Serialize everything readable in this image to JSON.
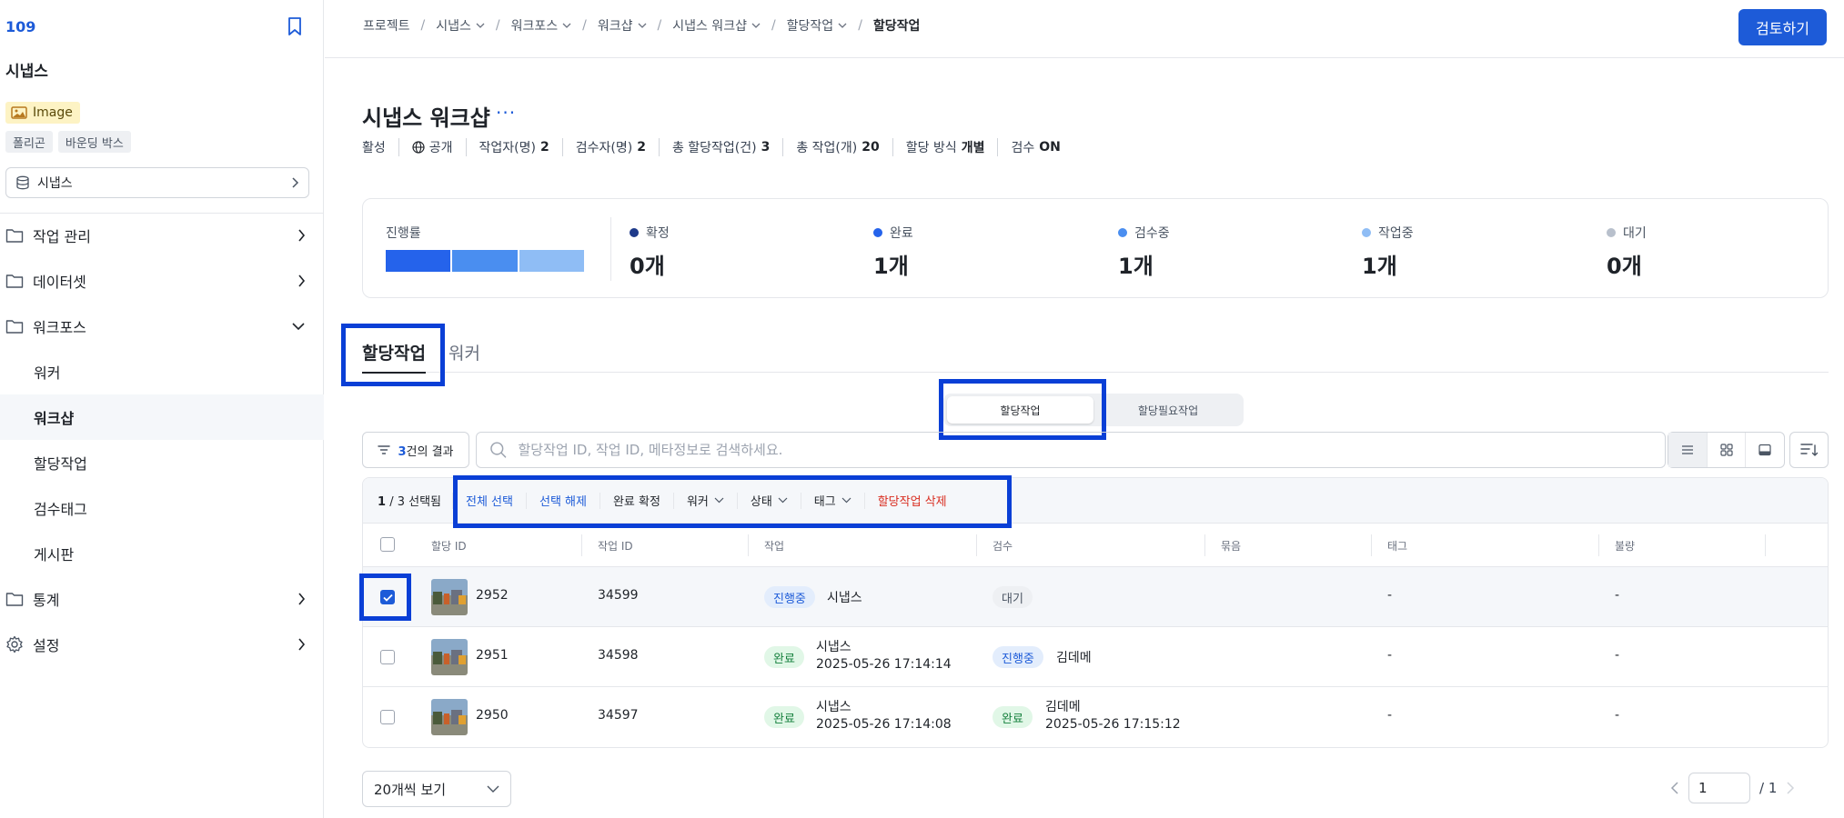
{
  "sidebar": {
    "project_id": "109",
    "project_title": "시냅스",
    "data_type": "Image",
    "annotation_tags": [
      "폴리곤",
      "바운딩 박스"
    ],
    "dataset_selector": "시냅스",
    "nav": {
      "work_mgmt": "작업 관리",
      "dataset": "데이터셋",
      "workforce": "워크포스",
      "worker": "워커",
      "workshop": "워크샵",
      "assigned": "할당작업",
      "review_tag": "검수태그",
      "board": "게시판",
      "stats": "통계",
      "settings": "설정"
    }
  },
  "breadcrumb": {
    "project": "프로젝트",
    "synapse": "시냅스",
    "workforce": "워크포스",
    "workshop": "워크샵",
    "synapse_workshop": "시냅스 워크샵",
    "assigned": "할당작업",
    "current": "할당작업"
  },
  "header": {
    "review_button": "검토하기",
    "title": "시냅스 워크샵",
    "more": "···",
    "status": "활성",
    "visibility": "공개",
    "workers_label": "작업자(명)",
    "workers": "2",
    "reviewers_label": "검수자(명)",
    "reviewers": "2",
    "total_assign_label": "총 할당작업(건)",
    "total_assign": "3",
    "total_tasks_label": "총 작업(개)",
    "total_tasks": "20",
    "assign_mode_label": "할당 방식",
    "assign_mode": "개별",
    "review_label": "검수",
    "review_value": "ON"
  },
  "stats": {
    "progress_label": "진행률",
    "progress_segments": [
      {
        "fraction": 0.3333,
        "color": "#2563eb"
      },
      {
        "fraction": 0.3333,
        "color": "#4a8ef0"
      },
      {
        "fraction": 0.3333,
        "color": "#8fbdf5"
      }
    ],
    "items": [
      {
        "label": "확정",
        "value": "0개",
        "color": "#1e3a8a"
      },
      {
        "label": "완료",
        "value": "1개",
        "color": "#2563eb"
      },
      {
        "label": "검수중",
        "value": "1개",
        "color": "#4a8ef0"
      },
      {
        "label": "작업중",
        "value": "1개",
        "color": "#8fbdf5"
      },
      {
        "label": "대기",
        "value": "0개",
        "color": "#b8c0cc"
      }
    ]
  },
  "tabs": {
    "assigned": "할당작업",
    "worker": "워커"
  },
  "segmented": {
    "assigned": "할당작업",
    "needs_assign": "할당필요작업"
  },
  "toolbar": {
    "result_count": "3",
    "result_suffix": "건의 결과",
    "search_placeholder": "할당작업 ID, 작업 ID, 메타정보로 검색하세요."
  },
  "bulk": {
    "selected": "1",
    "total": "/ 3",
    "selected_suffix": "선택됨",
    "select_all": "전체 선택",
    "deselect": "선택 해제",
    "confirm_done": "완료 확정",
    "worker": "워커",
    "status": "상태",
    "tag": "태그",
    "delete": "할당작업 삭제"
  },
  "table": {
    "columns": [
      "할당 ID",
      "작업 ID",
      "작업",
      "검수",
      "묶음",
      "태그",
      "불량"
    ],
    "rows": [
      {
        "assign_id": "2952",
        "task_id": "34599",
        "work_badge": "진행중",
        "work_user": "시냅스",
        "work_time": "",
        "review_badge": "대기",
        "review_user": "",
        "review_time": "",
        "tag": "-",
        "defect": "-",
        "checked": true
      },
      {
        "assign_id": "2951",
        "task_id": "34598",
        "work_badge": "완료",
        "work_user": "시냅스",
        "work_time": "2025-05-26 17:14:14",
        "review_badge": "진행중",
        "review_user": "김데메",
        "review_time": "",
        "tag": "-",
        "defect": "-",
        "checked": false
      },
      {
        "assign_id": "2950",
        "task_id": "34597",
        "work_badge": "완료",
        "work_user": "시냅스",
        "work_time": "2025-05-26 17:14:08",
        "review_badge": "완료",
        "review_user": "김데메",
        "review_time": "2025-05-26 17:15:12",
        "tag": "-",
        "defect": "-",
        "checked": false
      }
    ]
  },
  "footer": {
    "page_size": "20개씩 보기",
    "page": "1",
    "total_pages": "/ 1"
  },
  "colors": {
    "accent": "#1d5bd8",
    "highlight": "#0a3fd6",
    "danger": "#d92d20"
  }
}
